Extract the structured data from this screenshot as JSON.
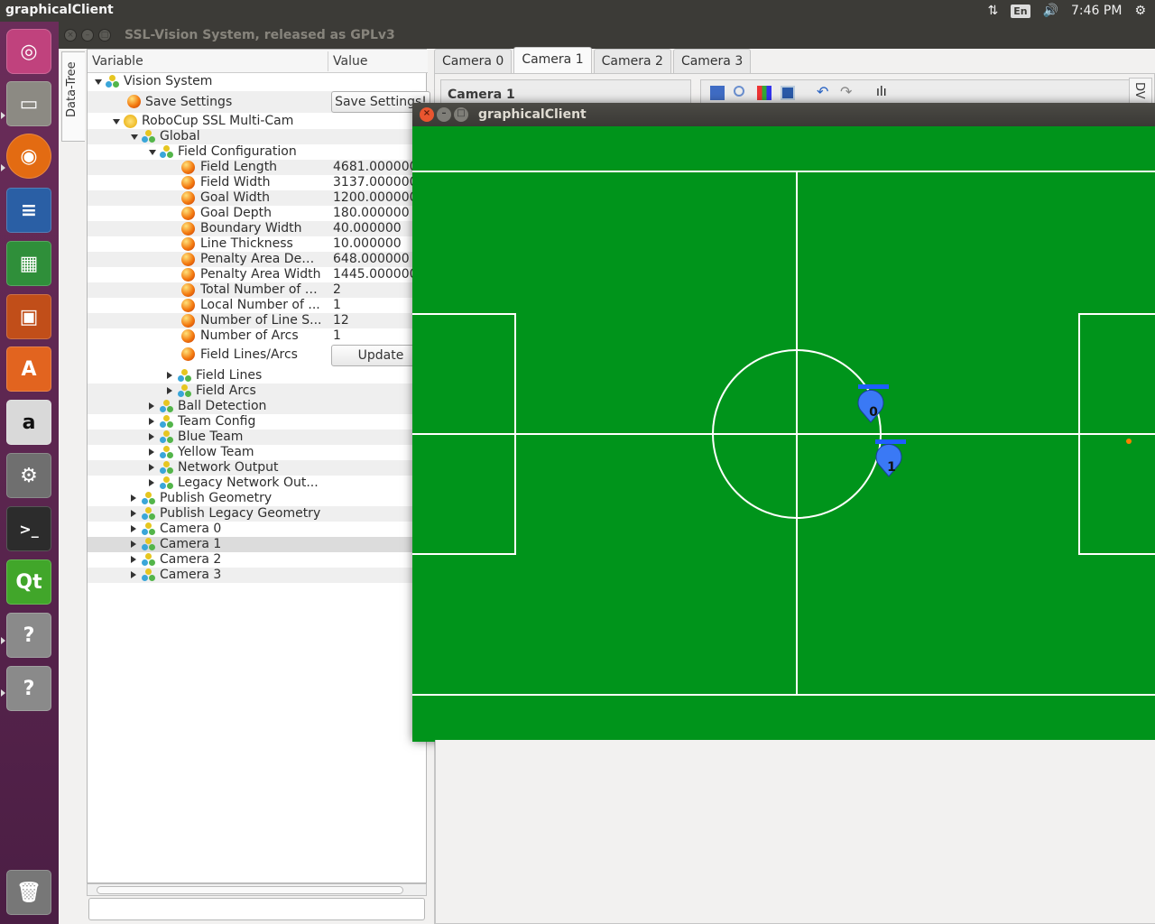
{
  "top_panel": {
    "app_name": "graphicalClient",
    "lang": "En",
    "time": "7:46 PM"
  },
  "back_window": {
    "title": "SSL-Vision System, released as GPLv3",
    "side_tab": "Data-Tree",
    "tree_header": {
      "variable": "Variable",
      "value": "Value"
    },
    "tree": {
      "vision_system": "Vision System",
      "save_settings": "Save Settings",
      "save_settings_btn": "Save Settings!",
      "robocup": "RoboCup SSL Multi-Cam",
      "global": "Global",
      "field_configuration": "Field Configuration",
      "params": [
        {
          "label": "Field Length",
          "value": "4681.000000"
        },
        {
          "label": "Field Width",
          "value": "3137.000000"
        },
        {
          "label": "Goal Width",
          "value": "1200.000000"
        },
        {
          "label": "Goal Depth",
          "value": "180.000000"
        },
        {
          "label": "Boundary Width",
          "value": "40.000000"
        },
        {
          "label": "Line Thickness",
          "value": "10.000000"
        },
        {
          "label": "Penalty Area Depth",
          "value": "648.000000"
        },
        {
          "label": "Penalty Area Width",
          "value": "1445.000000"
        },
        {
          "label": "Total Number of C...",
          "value": "2"
        },
        {
          "label": "Local Number of ...",
          "value": "1"
        },
        {
          "label": "Number of Line S...",
          "value": "12"
        },
        {
          "label": "Number of Arcs",
          "value": "1"
        }
      ],
      "field_lines_arcs": "Field Lines/Arcs",
      "update_btn": "Update",
      "sub_field": [
        "Field Lines",
        "Field Arcs"
      ],
      "sub_global": [
        "Ball Detection",
        "Team Config",
        "Blue Team",
        "Yellow Team",
        "Network Output",
        "Legacy Network Out..."
      ],
      "top_level": [
        "Publish Geometry",
        "Publish Legacy Geometry",
        "Camera 0",
        "Camera 1",
        "Camera 2",
        "Camera 3"
      ]
    },
    "tabs": [
      "Camera 0",
      "Camera 1",
      "Camera 2",
      "Camera 3"
    ],
    "active_tab": "Camera 1",
    "camera_group_title": "Camera 1",
    "dv_tab": "DV"
  },
  "front_window": {
    "title": "graphicalClient",
    "field_color": "#00941b",
    "robots": [
      {
        "id": "0",
        "team": "blue"
      },
      {
        "id": "1",
        "team": "blue"
      }
    ],
    "ball_color": "#ff7f00"
  }
}
